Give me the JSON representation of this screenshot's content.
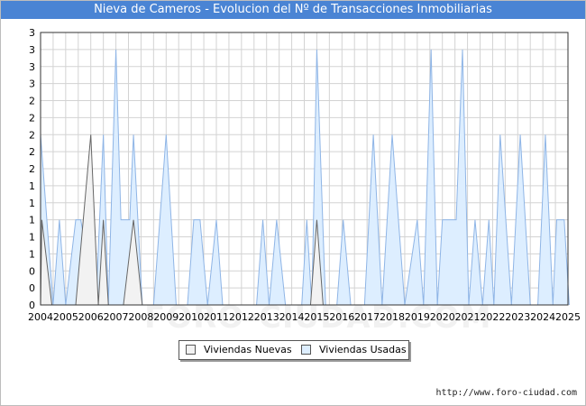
{
  "title": "Nieva de Cameros - Evolucion del Nº de Transacciones Inmobiliarias",
  "source": "http://www.foro-ciudad.com",
  "watermark": "FORO-CIUDAD.COM",
  "colors": {
    "title_bg": "#4a84d4",
    "nuevas_fill": "#f2f2f2",
    "nuevas_stroke": "#666666",
    "usadas_fill": "#ddeeff",
    "usadas_stroke": "#8fb5e6",
    "grid": "#d3d3d3"
  },
  "chart_data": {
    "type": "area",
    "x_start_year": 2004,
    "x_end_year": 2025,
    "periods_per_year": 12,
    "xlabels": [
      "2004",
      "2005",
      "2006",
      "2007",
      "2008",
      "2009",
      "2010",
      "2011",
      "2012",
      "2013",
      "2014",
      "2015",
      "2016",
      "2017",
      "2018",
      "2019",
      "2020",
      "2021",
      "2022",
      "2023",
      "2024",
      "2025"
    ],
    "ylim": [
      0,
      3.2
    ],
    "ytick_values": [
      0,
      0.2,
      0.4,
      0.6,
      0.8,
      1.0,
      1.2,
      1.4,
      1.6,
      1.8,
      2.0,
      2.2,
      2.4,
      2.6,
      2.8,
      3.0,
      3.2
    ],
    "yticks": [
      "0",
      "0",
      "0",
      "1",
      "1",
      "1",
      "1",
      "1",
      "2",
      "2",
      "2",
      "2",
      "2",
      "3",
      "3",
      "3",
      "3"
    ],
    "legend_position": "bottom-center",
    "series": [
      {
        "name": "Viviendas Nuevas",
        "points": [
          {
            "x": 2004.0,
            "y": 0
          },
          {
            "x": 2004.05,
            "y": 1
          },
          {
            "x": 2004.45,
            "y": 0
          },
          {
            "x": 2005.4,
            "y": 0
          },
          {
            "x": 2006.0,
            "y": 2
          },
          {
            "x": 2006.3,
            "y": 0
          },
          {
            "x": 2006.3,
            "y": 0
          },
          {
            "x": 2006.5,
            "y": 1
          },
          {
            "x": 2006.7,
            "y": 0
          },
          {
            "x": 2007.3,
            "y": 0
          },
          {
            "x": 2007.7,
            "y": 1
          },
          {
            "x": 2008.05,
            "y": 0
          },
          {
            "x": 2014.75,
            "y": 0
          },
          {
            "x": 2015.0,
            "y": 1
          },
          {
            "x": 2015.25,
            "y": 0
          }
        ]
      },
      {
        "name": "Viviendas Usadas",
        "points": [
          {
            "x": 2004.0,
            "y": 2
          },
          {
            "x": 2004.5,
            "y": 0
          },
          {
            "x": 2004.75,
            "y": 1
          },
          {
            "x": 2005.0,
            "y": 0
          },
          {
            "x": 2005.4,
            "y": 1
          },
          {
            "x": 2005.6,
            "y": 1
          },
          {
            "x": 2006.2,
            "y": 0
          },
          {
            "x": 2006.5,
            "y": 2
          },
          {
            "x": 2006.7,
            "y": 0
          },
          {
            "x": 2007.0,
            "y": 3
          },
          {
            "x": 2007.2,
            "y": 1
          },
          {
            "x": 2007.55,
            "y": 1
          },
          {
            "x": 2007.7,
            "y": 2
          },
          {
            "x": 2008.05,
            "y": 0
          },
          {
            "x": 2008.5,
            "y": 0
          },
          {
            "x": 2009.0,
            "y": 2
          },
          {
            "x": 2009.4,
            "y": 0
          },
          {
            "x": 2009.85,
            "y": 0
          },
          {
            "x": 2010.1,
            "y": 1
          },
          {
            "x": 2010.35,
            "y": 1
          },
          {
            "x": 2010.65,
            "y": 0
          },
          {
            "x": 2011.0,
            "y": 1
          },
          {
            "x": 2011.25,
            "y": 0
          },
          {
            "x": 2012.6,
            "y": 0
          },
          {
            "x": 2012.85,
            "y": 1
          },
          {
            "x": 2013.1,
            "y": 0
          },
          {
            "x": 2013.4,
            "y": 1
          },
          {
            "x": 2013.75,
            "y": 0
          },
          {
            "x": 2014.4,
            "y": 0
          },
          {
            "x": 2014.6,
            "y": 1
          },
          {
            "x": 2014.8,
            "y": 0
          },
          {
            "x": 2015.0,
            "y": 3
          },
          {
            "x": 2015.35,
            "y": 0
          },
          {
            "x": 2015.8,
            "y": 0
          },
          {
            "x": 2016.05,
            "y": 1
          },
          {
            "x": 2016.35,
            "y": 0
          },
          {
            "x": 2016.9,
            "y": 0
          },
          {
            "x": 2017.25,
            "y": 2
          },
          {
            "x": 2017.6,
            "y": 0
          },
          {
            "x": 2018.0,
            "y": 2
          },
          {
            "x": 2018.5,
            "y": 0
          },
          {
            "x": 2019.0,
            "y": 1
          },
          {
            "x": 2019.25,
            "y": 0
          },
          {
            "x": 2019.55,
            "y": 3
          },
          {
            "x": 2019.8,
            "y": 0
          },
          {
            "x": 2020.0,
            "y": 1
          },
          {
            "x": 2020.55,
            "y": 1
          },
          {
            "x": 2020.8,
            "y": 3
          },
          {
            "x": 2021.05,
            "y": 0
          },
          {
            "x": 2021.3,
            "y": 1
          },
          {
            "x": 2021.6,
            "y": 0
          },
          {
            "x": 2021.85,
            "y": 1
          },
          {
            "x": 2022.05,
            "y": 0
          },
          {
            "x": 2022.3,
            "y": 2
          },
          {
            "x": 2022.75,
            "y": 0
          },
          {
            "x": 2023.1,
            "y": 2
          },
          {
            "x": 2023.5,
            "y": 0
          },
          {
            "x": 2023.8,
            "y": 0
          },
          {
            "x": 2024.1,
            "y": 2
          },
          {
            "x": 2024.4,
            "y": 0
          },
          {
            "x": 2024.55,
            "y": 1
          },
          {
            "x": 2024.85,
            "y": 1
          },
          {
            "x": 2025.05,
            "y": 0
          }
        ]
      }
    ]
  }
}
